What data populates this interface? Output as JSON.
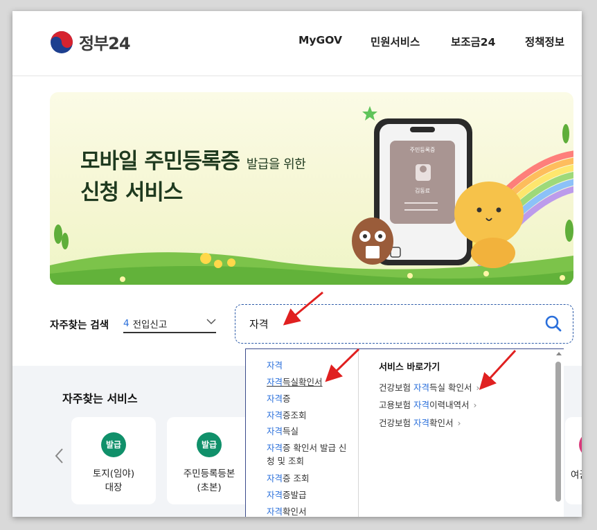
{
  "header": {
    "logo_text": "정부24",
    "nav": [
      "MyGOV",
      "민원서비스",
      "보조금24",
      "정책정보"
    ]
  },
  "banner": {
    "line1_main": "모바일 주민등록증",
    "line1_small": "발급을 위한",
    "line2": "신청 서비스",
    "phone_card_title": "주민등록증",
    "phone_card_name": "김동료"
  },
  "favorite_search": {
    "label": "자주찾는 검색",
    "selected_number": "4",
    "selected_text": "전입신고"
  },
  "search": {
    "value": "자격"
  },
  "autocomplete": {
    "keyword": "자격",
    "suggestions": [
      {
        "hl": "자격",
        "rest": ""
      },
      {
        "hl": "자격",
        "rest": "득실확인서"
      },
      {
        "hl": "자격",
        "rest": "증"
      },
      {
        "hl": "자격",
        "rest": "증조회"
      },
      {
        "hl": "자격",
        "rest": "득실"
      },
      {
        "hl": "자격",
        "rest": "증 확인서 발급 신청 및 조회"
      },
      {
        "hl": "자격",
        "rest": "증 조회"
      },
      {
        "hl": "자격",
        "rest": "증발급"
      },
      {
        "hl": "자격",
        "rest": "확인서"
      }
    ],
    "shortcut_title": "서비스 바로가기",
    "shortcuts": [
      {
        "pre": "건강보험 ",
        "hl": "자격",
        "post": "득실 확인서"
      },
      {
        "pre": "고용보험 ",
        "hl": "자격",
        "post": "이력내역서"
      },
      {
        "pre": "건강보험 ",
        "hl": "자격",
        "post": "확인서"
      }
    ],
    "shortcut_arrow": "›"
  },
  "services": {
    "title": "자주찾는 서비스",
    "cards": [
      {
        "badge": "발급",
        "label_line1": "토지(임야)",
        "label_line2": "대장"
      },
      {
        "badge": "발급",
        "label_line1": "주민등록등본",
        "label_line2": "(초본)"
      }
    ],
    "partial_card_label": "여권"
  },
  "colors": {
    "accent_blue": "#2a6fdb",
    "badge_green": "#10906a",
    "annotation_red": "#e02020"
  }
}
